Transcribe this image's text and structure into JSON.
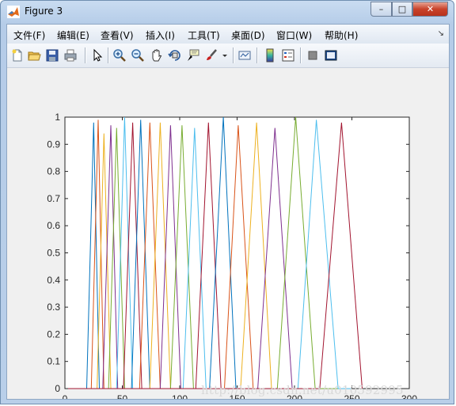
{
  "window": {
    "title": "Figure 3",
    "buttons": {
      "minimize": "–",
      "maximize": "□",
      "close": "✕"
    }
  },
  "menu": {
    "items": [
      "文件(F)",
      "编辑(E)",
      "查看(V)",
      "插入(I)",
      "工具(T)",
      "桌面(D)",
      "窗口(W)",
      "帮助(H)"
    ],
    "overflow_arrow": "↘"
  },
  "toolbar": {
    "icons": [
      "new-figure-icon",
      "open-file-icon",
      "save-icon",
      "print-icon",
      "edit-plot-arrow-icon",
      "zoom-in-icon",
      "zoom-out-icon",
      "pan-hand-icon",
      "rotate-3d-icon",
      "data-cursor-icon",
      "brush-icon",
      "brush-dropdown-icon",
      "link-plot-icon",
      "insert-colorbar-icon",
      "insert-legend-icon",
      "hide-plot-tools-icon",
      "show-plot-tools-icon"
    ]
  },
  "watermark": "http://blog.csdn.net/u010592995",
  "chart_data": {
    "type": "line",
    "title": "",
    "xlabel": "",
    "ylabel": "",
    "xlim": [
      0,
      300
    ],
    "ylim": [
      0,
      1
    ],
    "xticks": [
      "0",
      "50",
      "100",
      "150",
      "200",
      "250",
      "300"
    ],
    "yticks": [
      "0",
      "0.1",
      "0.2",
      "0.3",
      "0.4",
      "0.5",
      "0.6",
      "0.7",
      "0.8",
      "0.9",
      "1"
    ],
    "grid": false,
    "series_colors": [
      "#0072BD",
      "#D95319",
      "#EDB120",
      "#7E2F8E",
      "#77AC30",
      "#4DBEEE",
      "#A2142F"
    ],
    "series": [
      {
        "x": [
          19,
          25,
          30,
          250
        ],
        "y": [
          0,
          0.98,
          0,
          0
        ]
      },
      {
        "x": [
          0,
          23,
          29,
          34,
          250
        ],
        "y": [
          0,
          0,
          0.99,
          0,
          0
        ]
      },
      {
        "x": [
          0,
          28,
          34,
          40,
          250
        ],
        "y": [
          0,
          0,
          0.94,
          0,
          0
        ]
      },
      {
        "x": [
          0,
          33,
          40,
          46,
          250
        ],
        "y": [
          0,
          0,
          0.97,
          0,
          0
        ]
      },
      {
        "x": [
          0,
          38,
          45,
          52,
          250
        ],
        "y": [
          0,
          0,
          0.96,
          0,
          0
        ]
      },
      {
        "x": [
          0,
          45,
          52,
          59,
          250
        ],
        "y": [
          0,
          0,
          1.0,
          0,
          0
        ]
      },
      {
        "x": [
          0,
          51,
          59,
          67,
          250
        ],
        "y": [
          0,
          0,
          0.98,
          0,
          0
        ]
      },
      {
        "x": [
          0,
          58,
          66,
          74,
          250
        ],
        "y": [
          0,
          0,
          0.99,
          0,
          0
        ]
      },
      {
        "x": [
          0,
          65,
          74,
          83,
          250
        ],
        "y": [
          0,
          0,
          0.98,
          0,
          0
        ]
      },
      {
        "x": [
          0,
          74,
          83,
          92,
          250
        ],
        "y": [
          0,
          0,
          0.98,
          0,
          0
        ]
      },
      {
        "x": [
          0,
          83,
          92,
          101,
          250
        ],
        "y": [
          0,
          0,
          0.97,
          0,
          0
        ]
      },
      {
        "x": [
          0,
          92,
          102,
          112,
          250
        ],
        "y": [
          0,
          0,
          0.97,
          0,
          0
        ]
      },
      {
        "x": [
          0,
          103,
          113,
          123,
          250
        ],
        "y": [
          0,
          0,
          0.96,
          0,
          0
        ]
      },
      {
        "x": [
          0,
          114,
          125,
          136,
          250
        ],
        "y": [
          0,
          0,
          0.98,
          0,
          0
        ]
      },
      {
        "x": [
          0,
          126,
          138,
          149,
          250
        ],
        "y": [
          0,
          0,
          1.0,
          0,
          0
        ]
      },
      {
        "x": [
          0,
          139,
          151,
          164,
          250
        ],
        "y": [
          0,
          0,
          0.97,
          0,
          0
        ]
      },
      {
        "x": [
          0,
          153,
          167,
          180,
          250
        ],
        "y": [
          0,
          0,
          0.98,
          0,
          0
        ]
      },
      {
        "x": [
          0,
          168,
          183,
          198,
          250
        ],
        "y": [
          0,
          0,
          0.96,
          0,
          0
        ]
      },
      {
        "x": [
          0,
          185,
          201,
          218,
          250
        ],
        "y": [
          0,
          0,
          1.0,
          0,
          0
        ]
      },
      {
        "x": [
          0,
          203,
          219,
          238,
          250
        ],
        "y": [
          0,
          0,
          0.99,
          0,
          0
        ]
      },
      {
        "x": [
          0,
          222,
          241,
          259
        ],
        "y": [
          0,
          0,
          0.98,
          0
        ]
      }
    ]
  }
}
